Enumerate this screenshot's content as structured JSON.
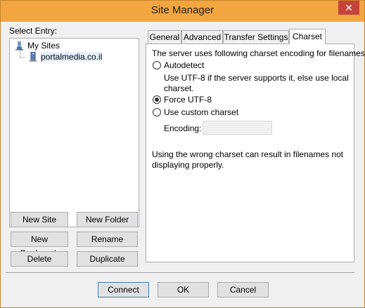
{
  "window": {
    "title": "Site Manager",
    "close_glyph": "✕"
  },
  "tree": {
    "label": "Select Entry:",
    "root": "My Sites",
    "site": "portalmedia.co.il"
  },
  "left_buttons": {
    "new_site": "New Site",
    "new_folder": "New Folder",
    "new_bookmark": "New Bookmark",
    "rename": "Rename",
    "delete": "Delete",
    "duplicate": "Duplicate"
  },
  "tabs": [
    "General",
    "Advanced",
    "Transfer Settings",
    "Charset"
  ],
  "active_tab": "Charset",
  "charset": {
    "intro": "The server uses following charset encoding for filenames:",
    "autodetect": "Autodetect",
    "autodetect_desc_1": "Use UTF-8 if the server supports it, else use local",
    "autodetect_desc_2": "charset.",
    "force_utf8": "Force UTF-8",
    "custom": "Use custom charset",
    "encoding_label": "Encoding:",
    "encoding_value": "",
    "selected": "force_utf8",
    "warning_1": "Using the wrong charset can result in filenames not",
    "warning_2": "displaying properly."
  },
  "bottom_buttons": {
    "connect": "Connect",
    "ok": "OK",
    "cancel": "Cancel"
  },
  "colors": {
    "titlebar": "#f2a641",
    "close": "#c7443b",
    "default_border": "#3c7fb1"
  }
}
